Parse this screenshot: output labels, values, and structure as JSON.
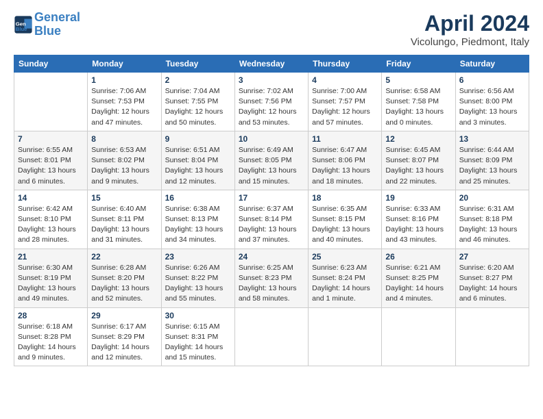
{
  "header": {
    "logo_line1": "General",
    "logo_line2": "Blue",
    "month_title": "April 2024",
    "subtitle": "Vicolungo, Piedmont, Italy"
  },
  "weekdays": [
    "Sunday",
    "Monday",
    "Tuesday",
    "Wednesday",
    "Thursday",
    "Friday",
    "Saturday"
  ],
  "weeks": [
    [
      {
        "day": "",
        "info": ""
      },
      {
        "day": "1",
        "info": "Sunrise: 7:06 AM\nSunset: 7:53 PM\nDaylight: 12 hours\nand 47 minutes."
      },
      {
        "day": "2",
        "info": "Sunrise: 7:04 AM\nSunset: 7:55 PM\nDaylight: 12 hours\nand 50 minutes."
      },
      {
        "day": "3",
        "info": "Sunrise: 7:02 AM\nSunset: 7:56 PM\nDaylight: 12 hours\nand 53 minutes."
      },
      {
        "day": "4",
        "info": "Sunrise: 7:00 AM\nSunset: 7:57 PM\nDaylight: 12 hours\nand 57 minutes."
      },
      {
        "day": "5",
        "info": "Sunrise: 6:58 AM\nSunset: 7:58 PM\nDaylight: 13 hours\nand 0 minutes."
      },
      {
        "day": "6",
        "info": "Sunrise: 6:56 AM\nSunset: 8:00 PM\nDaylight: 13 hours\nand 3 minutes."
      }
    ],
    [
      {
        "day": "7",
        "info": "Sunrise: 6:55 AM\nSunset: 8:01 PM\nDaylight: 13 hours\nand 6 minutes."
      },
      {
        "day": "8",
        "info": "Sunrise: 6:53 AM\nSunset: 8:02 PM\nDaylight: 13 hours\nand 9 minutes."
      },
      {
        "day": "9",
        "info": "Sunrise: 6:51 AM\nSunset: 8:04 PM\nDaylight: 13 hours\nand 12 minutes."
      },
      {
        "day": "10",
        "info": "Sunrise: 6:49 AM\nSunset: 8:05 PM\nDaylight: 13 hours\nand 15 minutes."
      },
      {
        "day": "11",
        "info": "Sunrise: 6:47 AM\nSunset: 8:06 PM\nDaylight: 13 hours\nand 18 minutes."
      },
      {
        "day": "12",
        "info": "Sunrise: 6:45 AM\nSunset: 8:07 PM\nDaylight: 13 hours\nand 22 minutes."
      },
      {
        "day": "13",
        "info": "Sunrise: 6:44 AM\nSunset: 8:09 PM\nDaylight: 13 hours\nand 25 minutes."
      }
    ],
    [
      {
        "day": "14",
        "info": "Sunrise: 6:42 AM\nSunset: 8:10 PM\nDaylight: 13 hours\nand 28 minutes."
      },
      {
        "day": "15",
        "info": "Sunrise: 6:40 AM\nSunset: 8:11 PM\nDaylight: 13 hours\nand 31 minutes."
      },
      {
        "day": "16",
        "info": "Sunrise: 6:38 AM\nSunset: 8:13 PM\nDaylight: 13 hours\nand 34 minutes."
      },
      {
        "day": "17",
        "info": "Sunrise: 6:37 AM\nSunset: 8:14 PM\nDaylight: 13 hours\nand 37 minutes."
      },
      {
        "day": "18",
        "info": "Sunrise: 6:35 AM\nSunset: 8:15 PM\nDaylight: 13 hours\nand 40 minutes."
      },
      {
        "day": "19",
        "info": "Sunrise: 6:33 AM\nSunset: 8:16 PM\nDaylight: 13 hours\nand 43 minutes."
      },
      {
        "day": "20",
        "info": "Sunrise: 6:31 AM\nSunset: 8:18 PM\nDaylight: 13 hours\nand 46 minutes."
      }
    ],
    [
      {
        "day": "21",
        "info": "Sunrise: 6:30 AM\nSunset: 8:19 PM\nDaylight: 13 hours\nand 49 minutes."
      },
      {
        "day": "22",
        "info": "Sunrise: 6:28 AM\nSunset: 8:20 PM\nDaylight: 13 hours\nand 52 minutes."
      },
      {
        "day": "23",
        "info": "Sunrise: 6:26 AM\nSunset: 8:22 PM\nDaylight: 13 hours\nand 55 minutes."
      },
      {
        "day": "24",
        "info": "Sunrise: 6:25 AM\nSunset: 8:23 PM\nDaylight: 13 hours\nand 58 minutes."
      },
      {
        "day": "25",
        "info": "Sunrise: 6:23 AM\nSunset: 8:24 PM\nDaylight: 14 hours\nand 1 minute."
      },
      {
        "day": "26",
        "info": "Sunrise: 6:21 AM\nSunset: 8:25 PM\nDaylight: 14 hours\nand 4 minutes."
      },
      {
        "day": "27",
        "info": "Sunrise: 6:20 AM\nSunset: 8:27 PM\nDaylight: 14 hours\nand 6 minutes."
      }
    ],
    [
      {
        "day": "28",
        "info": "Sunrise: 6:18 AM\nSunset: 8:28 PM\nDaylight: 14 hours\nand 9 minutes."
      },
      {
        "day": "29",
        "info": "Sunrise: 6:17 AM\nSunset: 8:29 PM\nDaylight: 14 hours\nand 12 minutes."
      },
      {
        "day": "30",
        "info": "Sunrise: 6:15 AM\nSunset: 8:31 PM\nDaylight: 14 hours\nand 15 minutes."
      },
      {
        "day": "",
        "info": ""
      },
      {
        "day": "",
        "info": ""
      },
      {
        "day": "",
        "info": ""
      },
      {
        "day": "",
        "info": ""
      }
    ]
  ]
}
